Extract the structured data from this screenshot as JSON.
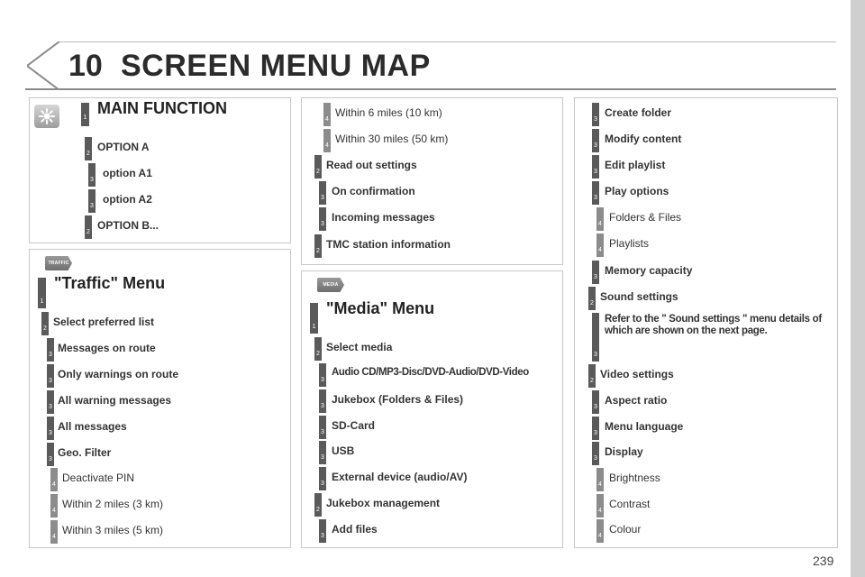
{
  "header": {
    "chapter": "10",
    "title": "SCREEN MENU MAP"
  },
  "page_number": "239",
  "icons": {
    "traffic_tab": "TRAFFIC",
    "media_tab": "MEDIA"
  },
  "main": {
    "items": [
      {
        "level": "1",
        "text": "MAIN FUNCTION"
      },
      {
        "level": "2",
        "text": "OPTION A"
      },
      {
        "level": "3",
        "text": "option A1"
      },
      {
        "level": "3",
        "text": "option A2"
      },
      {
        "level": "2",
        "text": "OPTION B..."
      }
    ]
  },
  "traffic": {
    "items": [
      {
        "level": "1",
        "text": "\"Traffic\" Menu"
      },
      {
        "level": "2",
        "text": "Select preferred list"
      },
      {
        "level": "3",
        "text": "Messages on route"
      },
      {
        "level": "3",
        "text": "Only warnings on route"
      },
      {
        "level": "3",
        "text": "All warning messages"
      },
      {
        "level": "3",
        "text": "All messages"
      },
      {
        "level": "3",
        "text": "Geo. Filter"
      },
      {
        "level": "4",
        "text": "Deactivate PIN"
      },
      {
        "level": "4",
        "text": "Within 2 miles (3 km)"
      },
      {
        "level": "4",
        "text": "Within 3 miles (5 km)"
      }
    ]
  },
  "traffic_cont": {
    "items": [
      {
        "level": "4",
        "text": "Within 6 miles (10 km)"
      },
      {
        "level": "4",
        "text": "Within 30 miles (50 km)"
      },
      {
        "level": "2",
        "text": "Read out settings"
      },
      {
        "level": "3",
        "text": "On confirmation"
      },
      {
        "level": "3",
        "text": "Incoming messages"
      },
      {
        "level": "2",
        "text": "TMC station information"
      }
    ]
  },
  "media": {
    "items": [
      {
        "level": "1",
        "text": "\"Media\" Menu"
      },
      {
        "level": "2",
        "text": "Select media"
      },
      {
        "level": "3",
        "text": "Audio CD/MP3-Disc/DVD-Audio/DVD-Video"
      },
      {
        "level": "3",
        "text": "Jukebox (Folders & Files)"
      },
      {
        "level": "3",
        "text": "SD-Card"
      },
      {
        "level": "3",
        "text": "USB"
      },
      {
        "level": "3",
        "text": "External device (audio/AV)"
      },
      {
        "level": "2",
        "text": "Jukebox management"
      },
      {
        "level": "3",
        "text": "Add files"
      }
    ]
  },
  "media_cont": {
    "items": [
      {
        "level": "3",
        "text": "Create folder"
      },
      {
        "level": "3",
        "text": "Modify content"
      },
      {
        "level": "3",
        "text": "Edit playlist"
      },
      {
        "level": "3",
        "text": "Play options"
      },
      {
        "level": "4",
        "text": "Folders & Files"
      },
      {
        "level": "4",
        "text": "Playlists"
      },
      {
        "level": "3",
        "text": "Memory capacity"
      },
      {
        "level": "2",
        "text": "Sound settings"
      },
      {
        "level": "3",
        "text": "Refer to the \" Sound settings \" menu details of which are shown on the next page."
      },
      {
        "level": "2",
        "text": "Video settings"
      },
      {
        "level": "3",
        "text": "Aspect ratio"
      },
      {
        "level": "3",
        "text": "Menu language"
      },
      {
        "level": "3",
        "text": "Display"
      },
      {
        "level": "4",
        "text": "Brightness"
      },
      {
        "level": "4",
        "text": "Contrast"
      },
      {
        "level": "4",
        "text": "Colour"
      }
    ]
  }
}
